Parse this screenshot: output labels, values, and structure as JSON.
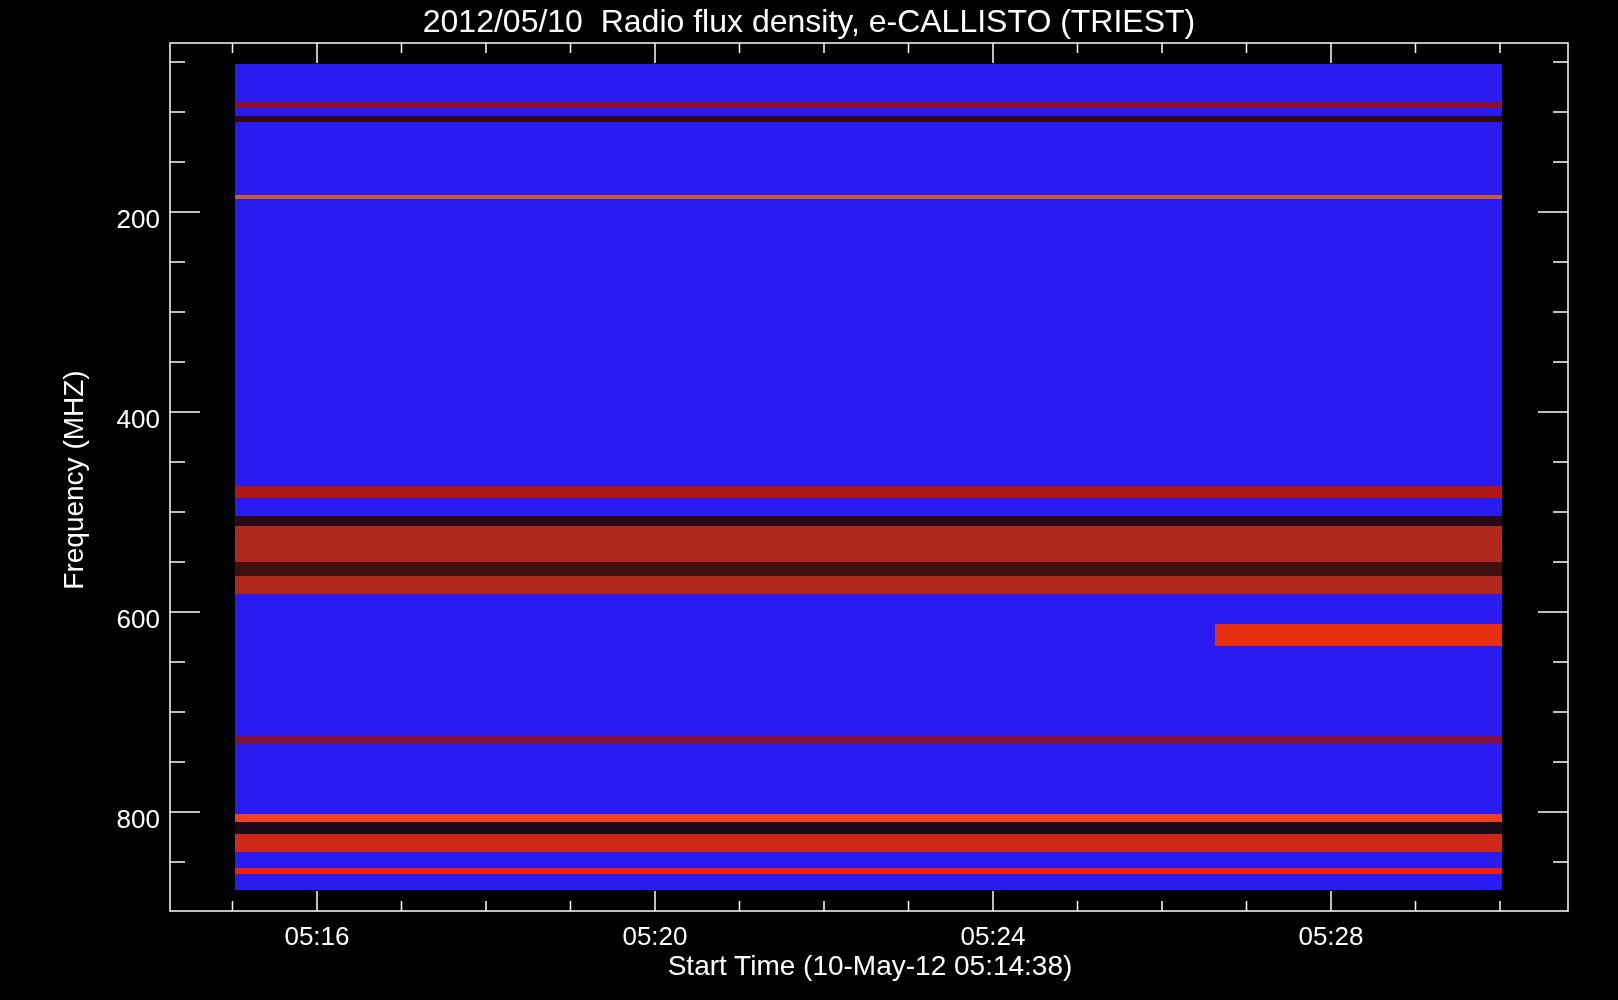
{
  "title": "2012/05/10  Radio flux density, e-CALLISTO (TRIEST)",
  "y_axis": {
    "label": "Frequency (MHZ)",
    "ticks": [
      "200",
      "400",
      "600",
      "800"
    ]
  },
  "x_axis": {
    "label": "Start Time (10-May-12 05:14:38)",
    "ticks": [
      "05:16",
      "05:20",
      "05:24",
      "05:28"
    ]
  }
}
